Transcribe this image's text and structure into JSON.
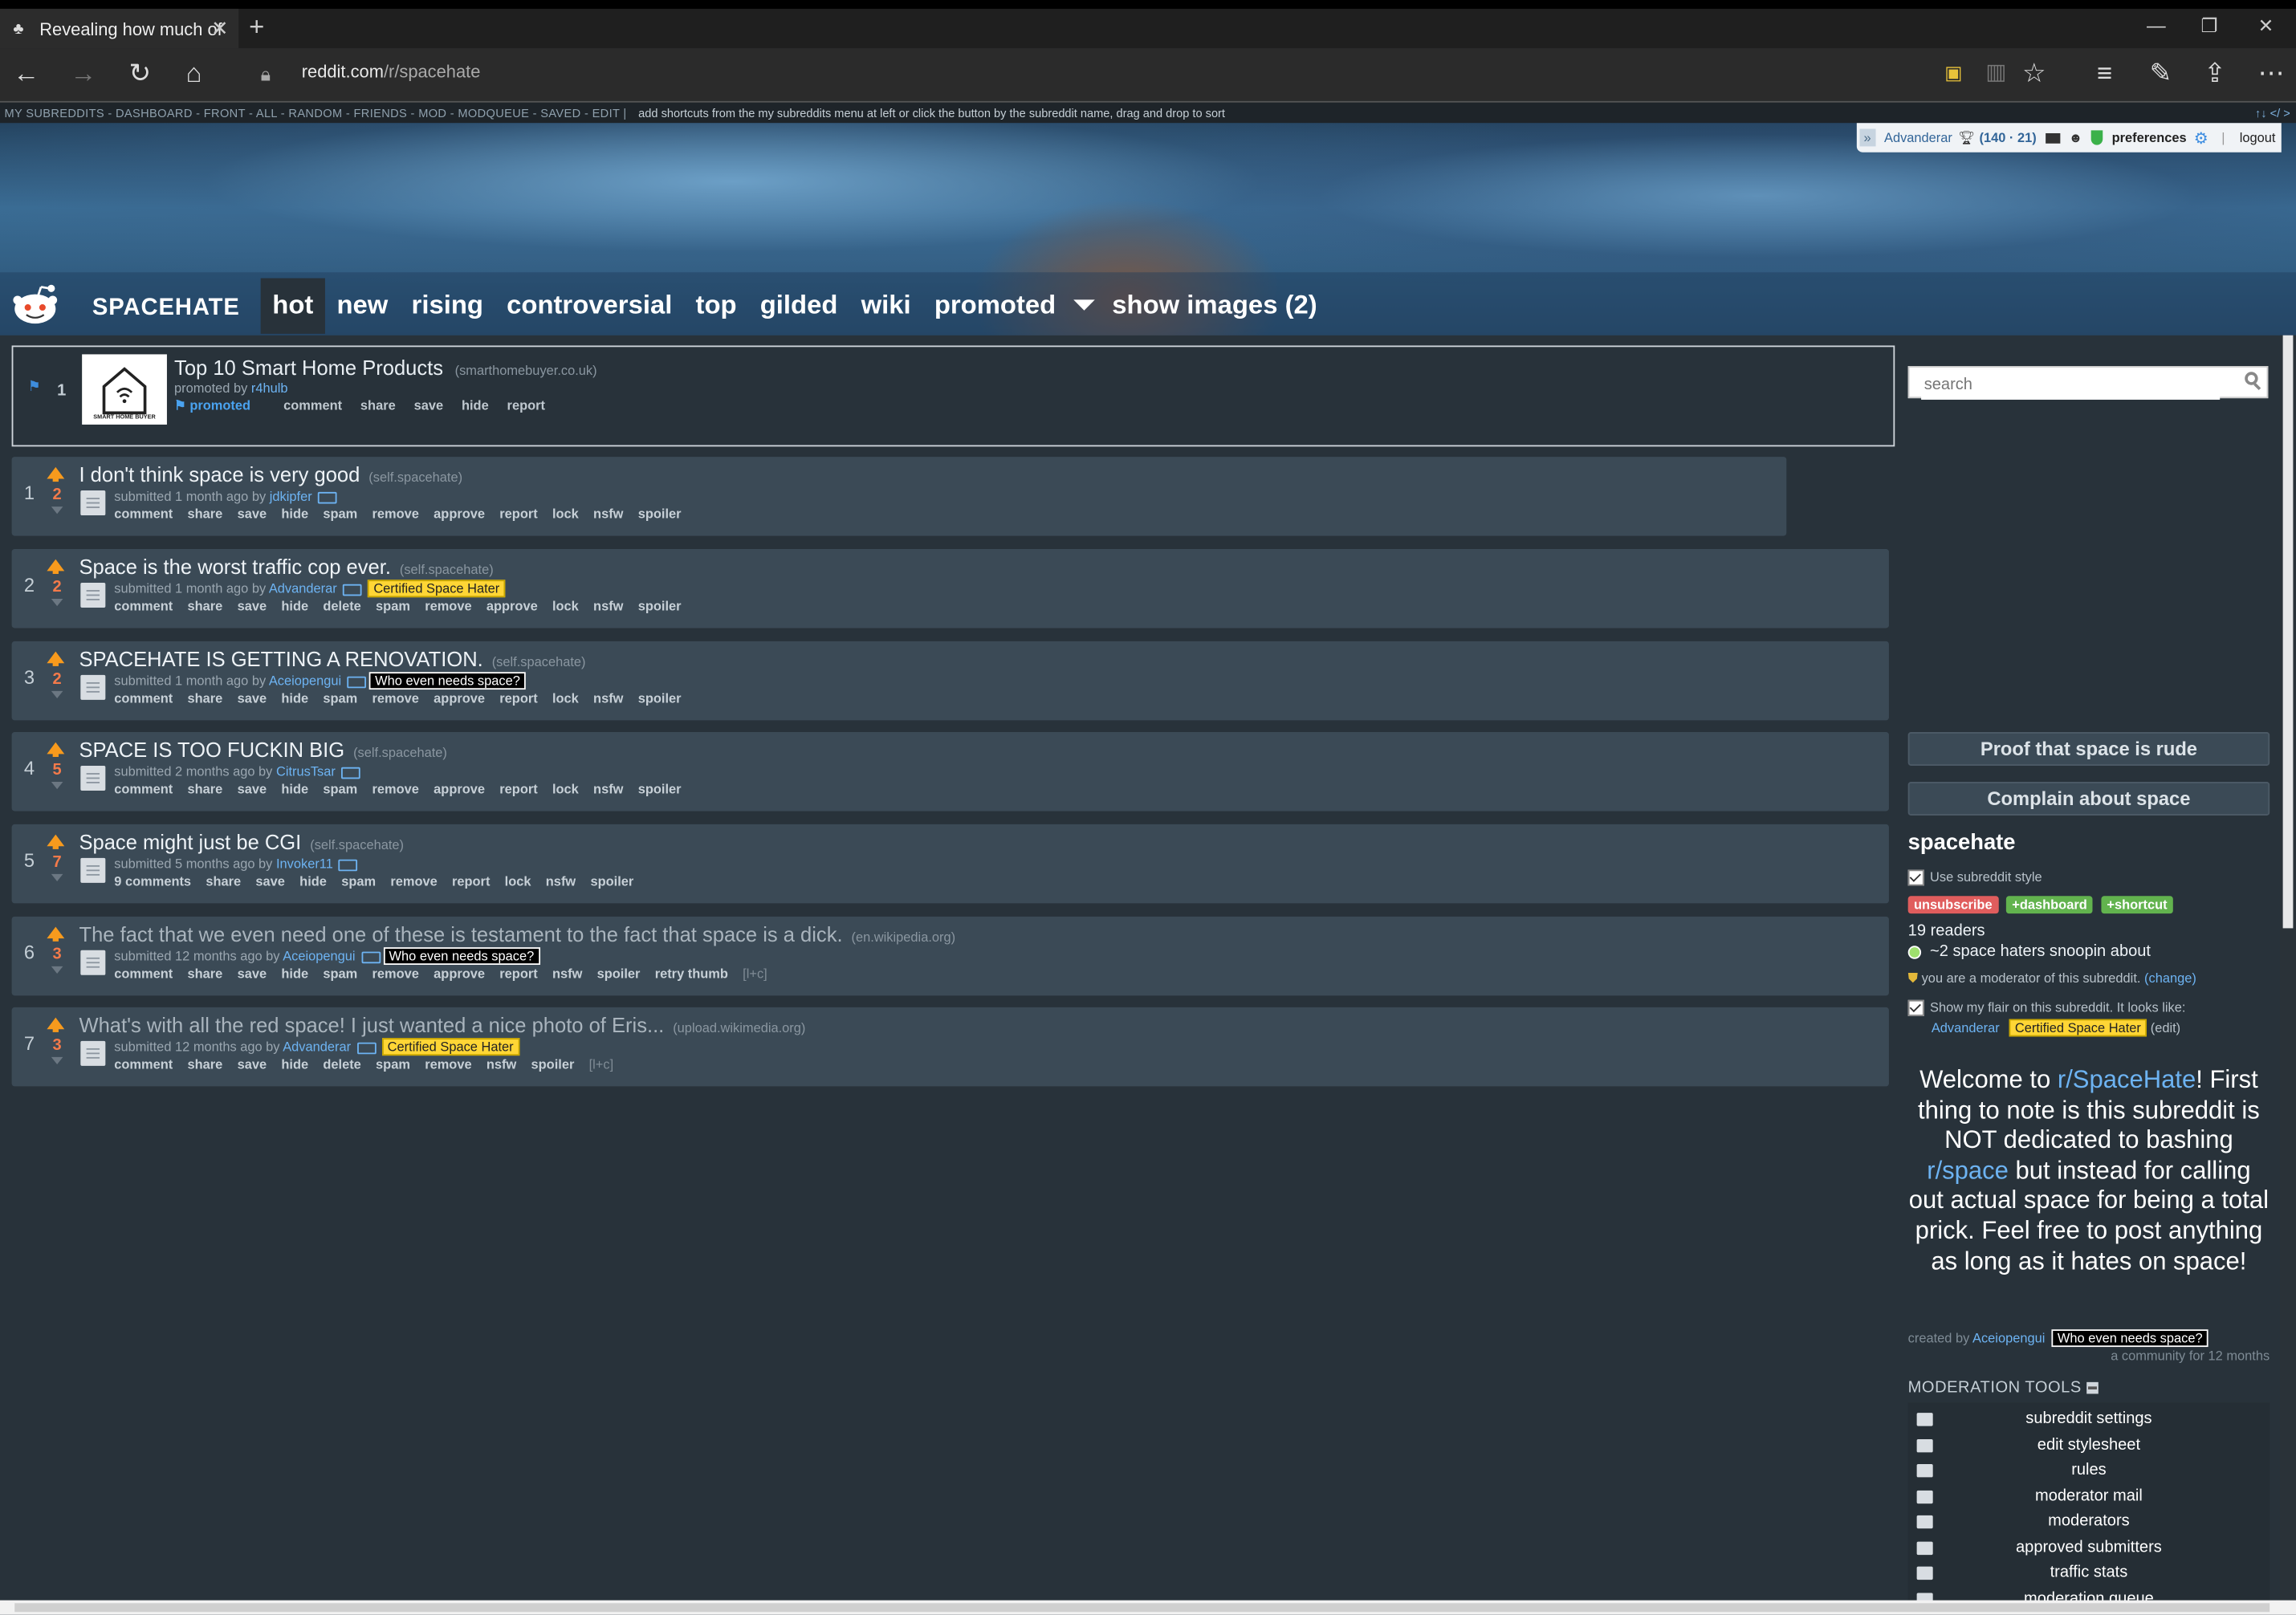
{
  "browser": {
    "tab_title": "Revealing how much of",
    "url_host": "reddit.com",
    "url_path": "/r/spacehate"
  },
  "reddit_bar": {
    "links": "MY SUBREDDITS - DASHBOARD - FRONT - ALL - RANDOM - FRIENDS - MOD - MODQUEUE - SAVED - EDIT",
    "hint": "add shortcuts from the my subreddits menu at left or click the button by the subreddit name, drag and drop to sort"
  },
  "userbox": {
    "username": "Advanderar",
    "karma": "(140 · 21)",
    "preferences": "preferences",
    "logout": "logout"
  },
  "header": {
    "subreddit": "SPACEHATE",
    "tabs": [
      "hot",
      "new",
      "rising",
      "controversial",
      "top",
      "gilded",
      "wiki",
      "promoted"
    ],
    "show_images": "show images (2)"
  },
  "promoted": {
    "rank": "1",
    "title": "Top 10 Smart Home Products",
    "domain": "(smarthomebuyer.co.uk)",
    "promoted_by": "promoted by",
    "author": "r4hulb",
    "thumb_label": "SMART HOME BUYER",
    "buttons": [
      "promoted",
      "comment",
      "share",
      "save",
      "hide",
      "report"
    ]
  },
  "posts": [
    {
      "rank": "1",
      "score": "2",
      "title": "I don't think space is very good",
      "domain": "(self.spacehate)",
      "age": "submitted 1 month ago by",
      "author": "jdkipfer",
      "flair": "",
      "buttons": [
        "comment",
        "share",
        "save",
        "hide",
        "spam",
        "remove",
        "approve",
        "report",
        "lock",
        "nsfw",
        "spoiler"
      ]
    },
    {
      "rank": "2",
      "score": "2",
      "title": "Space is the worst traffic cop ever.",
      "domain": "(self.spacehate)",
      "age": "submitted 1 month ago by",
      "author": "Advanderar",
      "flair": "Certified Space Hater",
      "buttons": [
        "comment",
        "share",
        "save",
        "hide",
        "delete",
        "spam",
        "remove",
        "approve",
        "lock",
        "nsfw",
        "spoiler"
      ]
    },
    {
      "rank": "3",
      "score": "2",
      "title": "SPACEHATE IS GETTING A RENOVATION.",
      "domain": "(self.spacehate)",
      "age": "submitted 1 month ago by",
      "author": "Aceiopengui",
      "flair": "Who even needs space?",
      "buttons": [
        "comment",
        "share",
        "save",
        "hide",
        "spam",
        "remove",
        "approve",
        "report",
        "lock",
        "nsfw",
        "spoiler"
      ]
    },
    {
      "rank": "4",
      "score": "5",
      "title": "SPACE IS TOO FUCKIN BIG",
      "domain": "(self.spacehate)",
      "age": "submitted 2 months ago by",
      "author": "CitrusTsar",
      "flair": "",
      "buttons": [
        "comment",
        "share",
        "save",
        "hide",
        "spam",
        "remove",
        "approve",
        "report",
        "lock",
        "nsfw",
        "spoiler"
      ]
    },
    {
      "rank": "5",
      "score": "7",
      "title": "Space might just be CGI",
      "domain": "(self.spacehate)",
      "age": "submitted 5 months ago by",
      "author": "Invoker11",
      "flair": "",
      "buttons": [
        "9 comments",
        "share",
        "save",
        "hide",
        "spam",
        "remove",
        "report",
        "lock",
        "nsfw",
        "spoiler"
      ]
    },
    {
      "rank": "6",
      "score": "3",
      "title": "The fact that we even need one of these is testament to the fact that space is a dick.",
      "domain": "(en.wikipedia.org)",
      "age": "submitted 12 months ago by",
      "author": "Aceiopengui",
      "flair": "Who even needs space?",
      "buttons": [
        "comment",
        "share",
        "save",
        "hide",
        "spam",
        "remove",
        "approve",
        "report",
        "nsfw",
        "spoiler",
        "retry thumb"
      ],
      "extra": "[l+c]"
    },
    {
      "rank": "7",
      "score": "3",
      "title": "What's with all the red space! I just wanted a nice photo of Eris...",
      "domain": "(upload.wikimedia.org)",
      "age": "submitted 12 months ago by",
      "author": "Advanderar",
      "flair": "Certified Space Hater",
      "buttons": [
        "comment",
        "share",
        "save",
        "hide",
        "delete",
        "spam",
        "remove",
        "nsfw",
        "spoiler"
      ],
      "extra": "[l+c]"
    }
  ],
  "sidebar": {
    "search_placeholder": "search",
    "button1": "Proof that space is rude",
    "button2": "Complain about space",
    "title": "spacehate",
    "use_style": "Use subreddit style",
    "unsubscribe": "unsubscribe",
    "dashboard": "+dashboard",
    "shortcut": "+shortcut",
    "readers": "19 readers",
    "online": "~2 space haters snoopin about",
    "mod_note": "you are a moderator of this subreddit.",
    "mod_change": "(change)",
    "flair_note": "Show my flair on this subreddit. It looks like:",
    "flair_user": "Advanderar",
    "flair_text": "Certified Space Hater",
    "flair_edit": "(edit)",
    "welcome_1": "Welcome to ",
    "welcome_link1": "r/SpaceHate",
    "welcome_2": "! First thing to note is this subreddit is NOT dedicated to bashing ",
    "welcome_link2": "r/space",
    "welcome_3": " but instead for calling out actual space for being a total prick. Feel free to post anything as long as it hates on space!",
    "created_by": "created by",
    "creator": "Aceiopengui",
    "creator_flair": "Who even needs space?",
    "community_age": "a community for 12 months",
    "mod_tools_title": "MODERATION TOOLS",
    "mod_tools": [
      "subreddit settings",
      "edit stylesheet",
      "rules",
      "moderator mail",
      "moderators",
      "approved submitters",
      "traffic stats",
      "moderation queue"
    ]
  }
}
